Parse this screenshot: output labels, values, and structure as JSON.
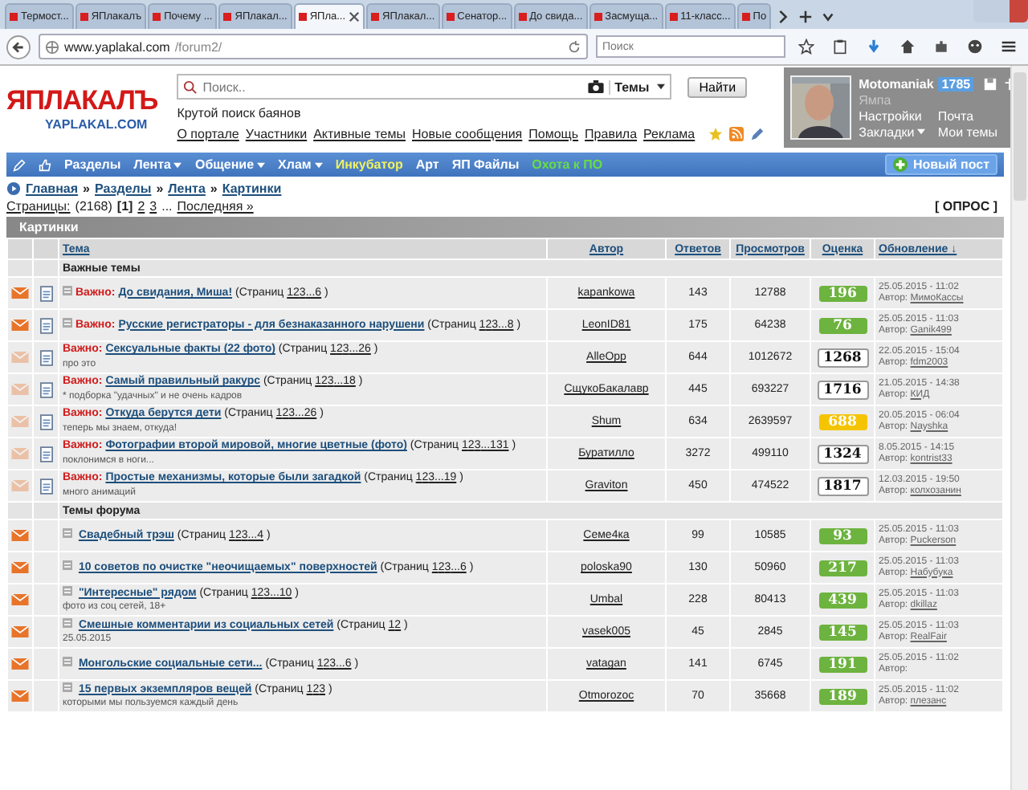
{
  "browser": {
    "tabs": [
      {
        "label": "Термост...",
        "selected": false
      },
      {
        "label": "ЯПлакалъ",
        "selected": false
      },
      {
        "label": "Почему ...",
        "selected": false
      },
      {
        "label": "ЯПлакал...",
        "selected": false
      },
      {
        "label": "ЯПла...",
        "selected": true
      },
      {
        "label": "ЯПлакал...",
        "selected": false
      },
      {
        "label": "Сенатор...",
        "selected": false
      },
      {
        "label": "До свида...",
        "selected": false
      },
      {
        "label": "Засмуща...",
        "selected": false
      },
      {
        "label": "11-класс...",
        "selected": false
      },
      {
        "label": "По",
        "selected": false
      }
    ],
    "url_host": "www.yaplakal.com",
    "url_path": "/forum2/",
    "search_placeholder": "Поиск"
  },
  "header": {
    "logo": "ЯПЛАКАЛЪ",
    "logo_sub": "YAPLAKAL.COM",
    "search_placeholder": "Поиск..",
    "search_scope": "Темы",
    "search_button": "Найти",
    "tagline": "Крутой поиск баянов",
    "links": [
      "О портале",
      "Участники",
      "Активные темы",
      "Новые сообщения",
      "Помощь",
      "Правила",
      "Реклама"
    ],
    "user": {
      "name": "Motomaniak",
      "karma": "1785",
      "rank": "Ямпа",
      "links": [
        {
          "label": "Настройки",
          "dropdown": false
        },
        {
          "label": "Почта",
          "dropdown": false
        },
        {
          "label": "Закладки",
          "dropdown": true
        },
        {
          "label": "Мои темы",
          "dropdown": false
        }
      ]
    }
  },
  "nav": {
    "items": [
      {
        "label": "Разделы",
        "dropdown": false,
        "color": "#ffffff"
      },
      {
        "label": "Лента",
        "dropdown": true,
        "color": "#ffffff"
      },
      {
        "label": "Общение",
        "dropdown": true,
        "color": "#ffffff"
      },
      {
        "label": "Хлам",
        "dropdown": true,
        "color": "#ffffff"
      },
      {
        "label": "Инкубатор",
        "dropdown": false,
        "color": "#f0f060"
      },
      {
        "label": "Арт",
        "dropdown": false,
        "color": "#ffffff"
      },
      {
        "label": "ЯП Файлы",
        "dropdown": false,
        "color": "#ffffff"
      },
      {
        "label": "Охота к ПО",
        "dropdown": false,
        "color": "#66dd44"
      }
    ],
    "new_post": "Новый пост"
  },
  "breadcrumbs": {
    "items": [
      "Главная",
      "Разделы",
      "Лента",
      "Картинки"
    ],
    "separator": "»"
  },
  "pager": {
    "label": "Страницы:",
    "count": "(2168)",
    "current": "[1]",
    "pages": [
      "2",
      "3"
    ],
    "ellipsis": "...",
    "last": "Последняя »",
    "poll": "[ ОПРОС ]"
  },
  "forum": {
    "title": "Картинки",
    "columns": [
      "Тема",
      "Автор",
      "Ответов",
      "Просмотров",
      "Оценка",
      "Обновление ↓"
    ],
    "sections": [
      {
        "title": "Важные темы",
        "rows": [
          {
            "unread": true,
            "doc": true,
            "marker": true,
            "prefix": "Важно:",
            "title": "До свидания, Миша!",
            "pages_open": "(Страниц",
            "pages": [
              "1",
              "2",
              "3",
              "...6"
            ],
            "pages_close": ")",
            "author": "kapankowa",
            "replies": "143",
            "views": "12788",
            "rating": "196",
            "color": "#6db33f",
            "date": "25.05.2015 - 11:02",
            "by": "Автор:",
            "last_author": "МимоКассы"
          },
          {
            "unread": true,
            "doc": true,
            "marker": true,
            "prefix": "Важно:",
            "title": "Русские регистраторы - для безнаказанного нарушени",
            "pages_open": "(Страниц",
            "pages": [
              "1",
              "2",
              "3",
              "...8"
            ],
            "pages_close": ")",
            "author": "LeonID81",
            "replies": "175",
            "views": "64238",
            "rating": "76",
            "color": "#6db33f",
            "date": "25.05.2015 - 11:03",
            "by": "Автор:",
            "last_author": "Ganik499"
          },
          {
            "unread": false,
            "doc": true,
            "marker": false,
            "prefix": "Важно:",
            "title": "Сексуальные факты (22 фото)",
            "pages_open": "(Страниц",
            "pages": [
              "1",
              "2",
              "3",
              "...26"
            ],
            "pages_close": ")",
            "subtitle": "про это",
            "author": "AlleOpp",
            "replies": "644",
            "views": "1012672",
            "rating": "1268",
            "color": "#ffffff",
            "date": "22.05.2015 - 15:04",
            "by": "Автор:",
            "last_author": "fdm2003"
          },
          {
            "unread": false,
            "doc": true,
            "marker": false,
            "prefix": "Важно:",
            "title": "Самый правильный ракурс",
            "pages_open": "(Страниц",
            "pages": [
              "1",
              "2",
              "3",
              "...18"
            ],
            "pages_close": ")",
            "subtitle": "* подборка \"удачных\" и не очень кадров",
            "author": "СщукоБакалавр",
            "replies": "445",
            "views": "693227",
            "rating": "1716",
            "color": "#ffffff",
            "date": "21.05.2015 - 14:38",
            "by": "Автор:",
            "last_author": "КИД"
          },
          {
            "unread": false,
            "doc": true,
            "marker": false,
            "prefix": "Важно:",
            "title": "Откуда берутся дети",
            "pages_open": "(Страниц",
            "pages": [
              "1",
              "2",
              "3",
              "...26"
            ],
            "pages_close": ")",
            "subtitle": "теперь мы знаем, откуда!",
            "author": "Shum",
            "replies": "634",
            "views": "2639597",
            "rating": "688",
            "color": "#f5c400",
            "date": "20.05.2015 - 06:04",
            "by": "Автор:",
            "last_author": "Nayshka"
          },
          {
            "unread": false,
            "doc": true,
            "marker": false,
            "prefix": "Важно:",
            "title": "Фотографии второй мировой, многие цветные (фото)",
            "pages_open": "(Страниц",
            "pages": [
              "1",
              "2",
              "3",
              "...131"
            ],
            "pages_close": ")",
            "subtitle": "поклонимся в ноги...",
            "author": "Буратилло",
            "replies": "3272",
            "views": "499110",
            "rating": "1324",
            "color": "#ffffff",
            "date": "8.05.2015 - 14:15",
            "by": "Автор:",
            "last_author": "kontrist33"
          },
          {
            "unread": false,
            "doc": true,
            "marker": false,
            "prefix": "Важно:",
            "title": "Простые механизмы, которые были загадкой",
            "pages_open": "(Страниц",
            "pages": [
              "1",
              "2",
              "3",
              "...19"
            ],
            "pages_close": ")",
            "subtitle": "много анимаций",
            "author": "Graviton",
            "replies": "450",
            "views": "474522",
            "rating": "1817",
            "color": "#ffffff",
            "date": "12.03.2015 - 19:50",
            "by": "Автор:",
            "last_author": "колхозанин"
          }
        ]
      },
      {
        "title": "Темы форума",
        "rows": [
          {
            "unread": true,
            "doc": false,
            "marker": true,
            "title": "Свадебный трэш",
            "pages_open": "(Страниц",
            "pages": [
              "1",
              "2",
              "3",
              "...4"
            ],
            "pages_close": ")",
            "author": "Семе4ка",
            "replies": "99",
            "views": "10585",
            "rating": "93",
            "color": "#6db33f",
            "date": "25.05.2015 - 11:03",
            "by": "Автор:",
            "last_author": "Puckerson"
          },
          {
            "unread": true,
            "doc": false,
            "marker": true,
            "title": "10 советов по очистке \"неочищаемых\" поверхностей",
            "pages_open": "(Страниц",
            "pages": [
              "1",
              "2",
              "3",
              "...6"
            ],
            "pages_close": ")",
            "author": "poloska90",
            "replies": "130",
            "views": "50960",
            "rating": "217",
            "color": "#6db33f",
            "date": "25.05.2015 - 11:03",
            "by": "Автор:",
            "last_author": "Набубука"
          },
          {
            "unread": true,
            "doc": false,
            "marker": true,
            "title": "\"Интересные\" рядом",
            "pages_open": "(Страниц",
            "pages": [
              "1",
              "2",
              "3",
              "...10"
            ],
            "pages_close": ")",
            "subtitle": "фото из соц сетей, 18+",
            "author": "Umbal",
            "replies": "228",
            "views": "80413",
            "rating": "439",
            "color": "#6db33f",
            "date": "25.05.2015 - 11:03",
            "by": "Автор:",
            "last_author": "dkillaz"
          },
          {
            "unread": true,
            "doc": false,
            "marker": true,
            "title": "Смешные комментарии из социальных сетей",
            "pages_open": "(Страниц",
            "pages": [
              "1",
              "2"
            ],
            "pages_close": ")",
            "subtitle": "25.05.2015",
            "author": "vasek005",
            "replies": "45",
            "views": "2845",
            "rating": "145",
            "color": "#6db33f",
            "date": "25.05.2015 - 11:03",
            "by": "Автор:",
            "last_author": "RealFair"
          },
          {
            "unread": true,
            "doc": false,
            "marker": true,
            "title": "Монгольские социальные сети...",
            "pages_open": "(Страниц",
            "pages": [
              "1",
              "2",
              "3",
              "...6"
            ],
            "pages_close": ")",
            "author": "vatagan",
            "replies": "141",
            "views": "6745",
            "rating": "191",
            "color": "#6db33f",
            "date": "25.05.2015 - 11:02",
            "by": "Автор:"
          },
          {
            "unread": true,
            "doc": false,
            "marker": true,
            "title": "15 первых экземпляров вещей",
            "pages_open": "(Страниц",
            "pages": [
              "1",
              "2",
              "3"
            ],
            "pages_close": ")",
            "subtitle": "которыми мы пользуемся каждый день",
            "author": "Otmorozoc",
            "replies": "70",
            "views": "35668",
            "rating": "189",
            "color": "#6db33f",
            "date": "25.05.2015 - 11:02",
            "by": "Автор:",
            "last_author": "плезанс"
          }
        ]
      }
    ]
  }
}
